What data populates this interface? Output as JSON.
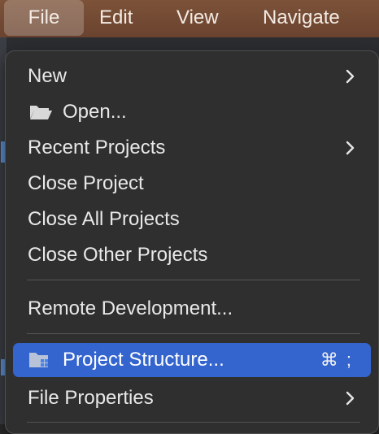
{
  "menubar": {
    "items": [
      {
        "label": "File",
        "active": true
      },
      {
        "label": "Edit",
        "active": false
      },
      {
        "label": "View",
        "active": false
      },
      {
        "label": "Navigate",
        "active": false
      }
    ]
  },
  "file_menu": {
    "items": [
      {
        "label": "New",
        "submenu": true
      },
      {
        "label": "Open...",
        "icon": "folder-open-icon"
      },
      {
        "label": "Recent Projects",
        "submenu": true
      },
      {
        "label": "Close Project"
      },
      {
        "label": "Close All Projects"
      },
      {
        "label": "Close Other Projects"
      },
      {
        "label": "Remote Development..."
      },
      {
        "label": "Project Structure...",
        "icon": "project-structure-icon",
        "shortcut": "⌘ ;",
        "selected": true
      },
      {
        "label": "File Properties",
        "submenu": true
      }
    ]
  },
  "colors": {
    "menubar": "#7c5238",
    "menu_background": "#2f2f2f",
    "selection": "#3465cf"
  }
}
